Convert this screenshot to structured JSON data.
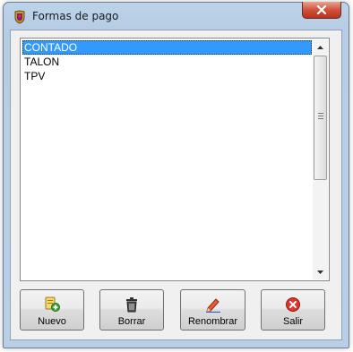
{
  "window": {
    "title": "Formas de pago"
  },
  "list": {
    "items": [
      {
        "label": "CONTADO",
        "selected": true
      },
      {
        "label": "TALON",
        "selected": false
      },
      {
        "label": "TPV",
        "selected": false
      }
    ]
  },
  "buttons": {
    "nuevo": {
      "label": "Nuevo",
      "icon": "add-document-icon"
    },
    "borrar": {
      "label": "Borrar",
      "icon": "trash-icon"
    },
    "renombrar": {
      "label": "Renombrar",
      "icon": "pencil-icon"
    },
    "salir": {
      "label": "Salir",
      "icon": "exit-icon"
    }
  },
  "colors": {
    "selection": "#3399ff",
    "close_button": "#c9462e",
    "window_frame": "#b9cfe6"
  }
}
